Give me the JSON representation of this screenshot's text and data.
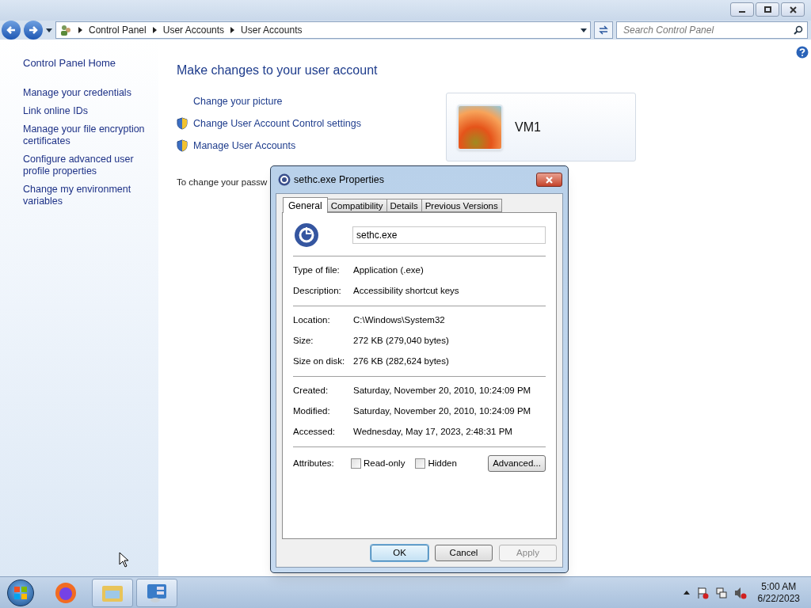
{
  "address_bar": {
    "breadcrumbs": [
      "Control Panel",
      "User Accounts",
      "User Accounts"
    ],
    "search_placeholder": "Search Control Panel"
  },
  "sidebar": {
    "home": "Control Panel Home",
    "items": [
      "Manage your credentials",
      "Link online IDs",
      "Manage your file encryption certificates",
      "Configure advanced user profile properties",
      "Change my environment variables"
    ]
  },
  "main": {
    "heading": "Make changes to your user account",
    "links": [
      {
        "label": "Change your picture",
        "shield": false
      },
      {
        "label": "Change User Account Control settings",
        "shield": true
      },
      {
        "label": "Manage User Accounts",
        "shield": true
      }
    ],
    "account_name": "VM1",
    "password_text": "To change your passw"
  },
  "dialog": {
    "title": "sethc.exe Properties",
    "tabs": [
      {
        "label": "General",
        "selected": true
      },
      {
        "label": "Compatibility",
        "selected": false
      },
      {
        "label": "Details",
        "selected": false
      },
      {
        "label": "Previous Versions",
        "selected": false
      }
    ],
    "file_name": "sethc.exe",
    "sections": [
      [
        {
          "label": "Type of file:",
          "value": "Application (.exe)"
        },
        {
          "label": "Description:",
          "value": "Accessibility shortcut keys"
        }
      ],
      [
        {
          "label": "Location:",
          "value": "C:\\Windows\\System32"
        },
        {
          "label": "Size:",
          "value": "272 KB (279,040 bytes)"
        },
        {
          "label": "Size on disk:",
          "value": "276 KB (282,624 bytes)"
        }
      ],
      [
        {
          "label": "Created:",
          "value": "Saturday, November 20, 2010, 10:24:09 PM"
        },
        {
          "label": "Modified:",
          "value": "Saturday, November 20, 2010, 10:24:09 PM"
        },
        {
          "label": "Accessed:",
          "value": "Wednesday, May 17, 2023, 2:48:31 PM"
        }
      ]
    ],
    "attributes": {
      "label": "Attributes:",
      "options": [
        {
          "label": "Read-only",
          "checked": false
        },
        {
          "label": "Hidden",
          "checked": false
        }
      ],
      "advanced": "Advanced..."
    },
    "buttons": [
      {
        "label": "OK",
        "default": true,
        "disabled": false
      },
      {
        "label": "Cancel",
        "default": false,
        "disabled": false
      },
      {
        "label": "Apply",
        "default": false,
        "disabled": true
      }
    ]
  },
  "taskbar": {
    "time": "5:00 AM",
    "date": "6/22/2023"
  }
}
